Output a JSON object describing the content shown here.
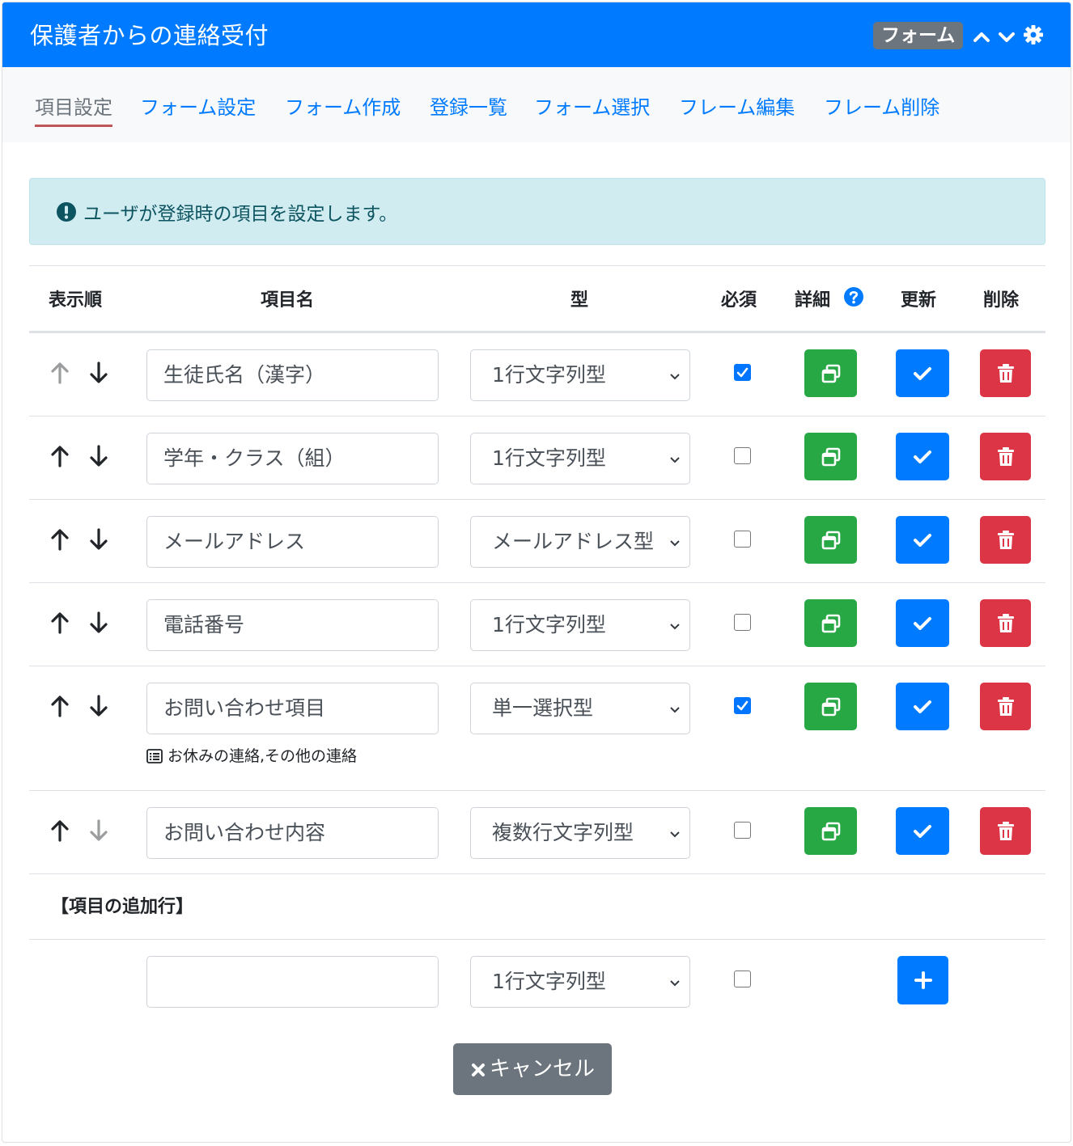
{
  "header": {
    "title": "保護者からの連絡受付",
    "badge": "フォーム"
  },
  "tabs": [
    {
      "label": "項目設定",
      "active": true
    },
    {
      "label": "フォーム設定"
    },
    {
      "label": "フォーム作成"
    },
    {
      "label": "登録一覧"
    },
    {
      "label": "フォーム選択"
    },
    {
      "label": "フレーム編集"
    },
    {
      "label": "フレーム削除"
    }
  ],
  "alert": {
    "text": "ユーザが登録時の項目を設定します。"
  },
  "table": {
    "headers": {
      "order": "表示順",
      "name": "項目名",
      "type": "型",
      "required": "必須",
      "detail": "詳細",
      "update": "更新",
      "delete": "削除"
    },
    "rows": [
      {
        "name": "生徒氏名（漢字）",
        "type": "1行文字列型",
        "required": true
      },
      {
        "name": "学年・クラス（組）",
        "type": "1行文字列型",
        "required": false
      },
      {
        "name": "メールアドレス",
        "type": "メールアドレス型",
        "required": false
      },
      {
        "name": "電話番号",
        "type": "1行文字列型",
        "required": false
      },
      {
        "name": "お問い合わせ項目",
        "type": "単一選択型",
        "required": true,
        "options": "お休みの連絡,その他の連絡"
      },
      {
        "name": "お問い合わせ内容",
        "type": "複数行文字列型",
        "required": false
      }
    ]
  },
  "add_row": {
    "label": "【項目の追加行】",
    "name_value": "",
    "type": "1行文字列型",
    "required": false
  },
  "cancel_label": "キャンセル",
  "colors": {
    "primary": "#007bff",
    "success": "#28a745",
    "danger": "#dc3545",
    "secondary": "#6c757d",
    "info_bg": "#d1ecf1"
  }
}
